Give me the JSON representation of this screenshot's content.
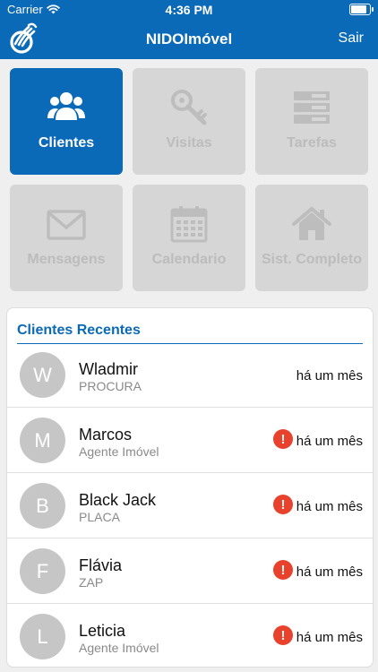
{
  "status_bar": {
    "carrier": "Carrier",
    "time": "4:36 PM",
    "battery_level": 0.95
  },
  "nav": {
    "title": "NIDOImóvel",
    "action_label": "Sair"
  },
  "colors": {
    "brand_blue": "#0b6ab7",
    "tile_disabled": "#d6d6d6",
    "alert_red": "#e8412c",
    "avatar_gray": "#c6c6c6"
  },
  "tiles": [
    {
      "label": "Clientes",
      "icon": "users-icon",
      "active": true
    },
    {
      "label": "Visitas",
      "icon": "key-icon",
      "active": false
    },
    {
      "label": "Tarefas",
      "icon": "server-list-icon",
      "active": false
    },
    {
      "label": "Mensagens",
      "icon": "envelope-icon",
      "active": false
    },
    {
      "label": "Calendario",
      "icon": "calendar-icon",
      "active": false
    },
    {
      "label": "Sist. Completo",
      "icon": "home-icon",
      "active": false
    }
  ],
  "recent": {
    "title": "Clientes Recentes",
    "clients": [
      {
        "initial": "W",
        "name": "Wladmir",
        "source": "PROCURA",
        "time": "há um mês",
        "alert": false
      },
      {
        "initial": "M",
        "name": "Marcos",
        "source": "Agente Imóvel",
        "time": "há um mês",
        "alert": true,
        "alert_symbol": "!"
      },
      {
        "initial": "B",
        "name": "Black Jack",
        "source": "PLACA",
        "time": "há um mês",
        "alert": true,
        "alert_symbol": "!"
      },
      {
        "initial": "F",
        "name": "Flávia",
        "source": "ZAP",
        "time": "há um mês",
        "alert": true,
        "alert_symbol": "!"
      },
      {
        "initial": "L",
        "name": "Leticia",
        "source": "Agente Imóvel",
        "time": "há um mês",
        "alert": true,
        "alert_symbol": "!"
      }
    ]
  }
}
